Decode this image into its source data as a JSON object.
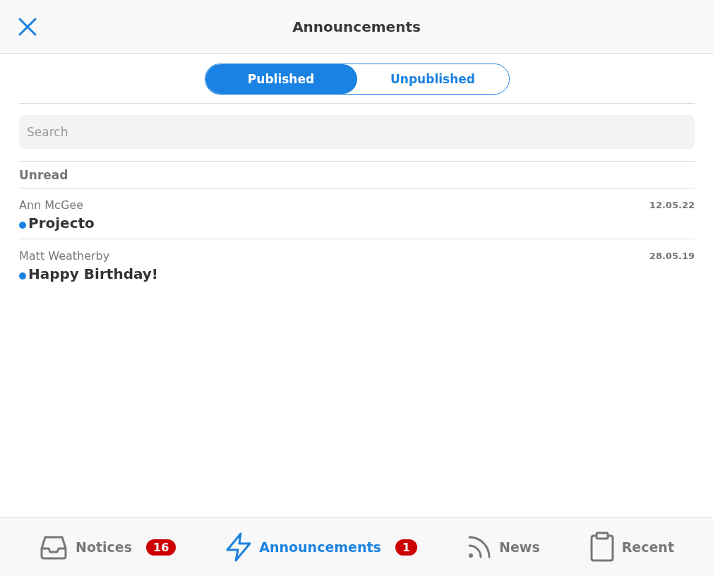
{
  "header": {
    "title": "Announcements"
  },
  "segments": [
    {
      "label": "Published",
      "selected": true
    },
    {
      "label": "Unpublished",
      "selected": false
    }
  ],
  "search": {
    "placeholder": "Search"
  },
  "section": "Unread",
  "announcements": [
    {
      "author": "Ann McGee",
      "title": "Projecto",
      "date": "12.05.22",
      "unread": true
    },
    {
      "author": "Matt Weatherby",
      "title": "Happy Birthday!",
      "date": "28.05.19",
      "unread": true
    }
  ],
  "tab_bar": [
    {
      "label": "Notices",
      "badge": "16",
      "selected": false
    },
    {
      "label": "Announcements",
      "badge": "1",
      "selected": true
    },
    {
      "label": "News",
      "selected": false
    },
    {
      "label": "Recent",
      "selected": false
    }
  ]
}
